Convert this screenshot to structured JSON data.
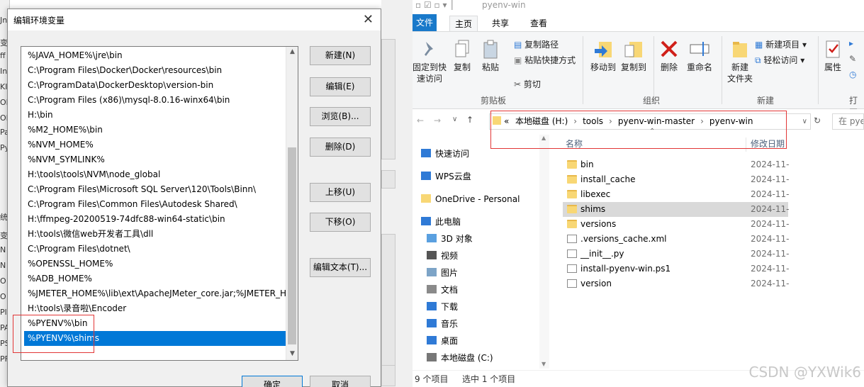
{
  "behind_window": {
    "fragments": [
      "Jn",
      "变",
      "ff",
      "In",
      "KI",
      "Ol",
      "OI",
      "Pa",
      "Py",
      "统",
      "变",
      "N",
      "N",
      "O",
      "O",
      "Pl",
      "PA",
      "PS",
      "PF"
    ]
  },
  "dialog": {
    "title": "编辑环境变量",
    "entries": [
      "%JAVA_HOME%\\jre\\bin",
      "C:\\Program Files\\Docker\\Docker\\resources\\bin",
      "C:\\ProgramData\\DockerDesktop\\version-bin",
      "C:\\Program Files (x86)\\mysql-8.0.16-winx64\\bin",
      "H:\\bin",
      "%M2_HOME%\\bin",
      "%NVM_HOME%",
      "%NVM_SYMLINK%",
      "H:\\tools\\tools\\NVM\\node_global",
      "C:\\Program Files\\Microsoft SQL Server\\120\\Tools\\Binn\\",
      "C:\\Program Files\\Common Files\\Autodesk Shared\\",
      "H:\\ffmpeg-20200519-74dfc88-win64-static\\bin",
      "H:\\tools\\微信web开发者工具\\dll",
      "C:\\Program Files\\dotnet\\",
      "%OPENSSL_HOME%",
      "%ADB_HOME%",
      "%JMETER_HOME%\\lib\\ext\\ApacheJMeter_core.jar;%JMETER_H...",
      "H:\\tools\\录音啦\\Encoder",
      "%PYENV%\\bin",
      "%PYENV%\\shims"
    ],
    "selected_index": 19,
    "buttons": {
      "new": "新建(N)",
      "edit": "编辑(E)",
      "browse": "浏览(B)...",
      "delete": "删除(D)",
      "move_up": "上移(U)",
      "move_down": "下移(O)",
      "edit_text": "编辑文本(T)...",
      "ok": "确定",
      "cancel": "取消"
    },
    "close_glyph": "✕"
  },
  "explorer": {
    "window_title": "pyenv-win",
    "tabs": {
      "file": "文件",
      "home": "主页",
      "share": "共享",
      "view": "查看"
    },
    "ribbon": {
      "pin": "固定到快\n速访问",
      "copy": "复制",
      "paste": "粘贴",
      "copy_path": "复制路径",
      "paste_shortcut": "粘贴快捷方式",
      "cut": "剪切",
      "clipboard_group": "剪贴板",
      "move_to": "移动到",
      "copy_to": "复制到",
      "delete": "删除",
      "rename": "重命名",
      "organize_group": "组织",
      "new_folder": "新建\n文件夹",
      "new_item": "新建项目",
      "easy_access": "轻松访问",
      "new_group": "新建",
      "properties": "属性",
      "open_group": "打开"
    },
    "address": {
      "prefix": "«",
      "parts": [
        "本地磁盘 (H:)",
        "tools",
        "pyenv-win-master",
        "pyenv-win"
      ],
      "sep": "›",
      "search_placeholder": "在 pye"
    },
    "nav": [
      {
        "label": "快速访问",
        "icon": "star-icon",
        "color": "#2f7ad6"
      },
      {
        "label": "WPS云盘",
        "icon": "cloud-icon",
        "color": "#2f7ad6"
      },
      {
        "label": "OneDrive - Personal",
        "icon": "folder-icon",
        "color": "#f8d775"
      },
      {
        "label": "此电脑",
        "icon": "computer-icon",
        "color": "#2f7ad6"
      },
      {
        "label": "3D 对象",
        "icon": "cube-icon",
        "color": "#5aa0e0"
      },
      {
        "label": "视频",
        "icon": "video-icon",
        "color": "#555"
      },
      {
        "label": "图片",
        "icon": "pictures-icon",
        "color": "#7da4c7"
      },
      {
        "label": "文档",
        "icon": "documents-icon",
        "color": "#8a8a8a"
      },
      {
        "label": "下载",
        "icon": "download-icon",
        "color": "#2f7ad6"
      },
      {
        "label": "音乐",
        "icon": "music-icon",
        "color": "#2f7ad6"
      },
      {
        "label": "桌面",
        "icon": "desktop-icon",
        "color": "#2f7ad6"
      },
      {
        "label": "本地磁盘 (C:)",
        "icon": "drive-icon",
        "color": "#777"
      }
    ],
    "columns": {
      "name": "名称",
      "date": "修改日期"
    },
    "files": [
      {
        "name": "bin",
        "date": "2024-11-",
        "type": "folder"
      },
      {
        "name": "install_cache",
        "date": "2024-11-",
        "type": "folder"
      },
      {
        "name": "libexec",
        "date": "2024-11-",
        "type": "folder"
      },
      {
        "name": "shims",
        "date": "2024-11-",
        "type": "folder"
      },
      {
        "name": "versions",
        "date": "2024-11-",
        "type": "folder"
      },
      {
        "name": ".versions_cache.xml",
        "date": "2024-11-",
        "type": "xml"
      },
      {
        "name": "__init__.py",
        "date": "2024-11-",
        "type": "py"
      },
      {
        "name": "install-pyenv-win.ps1",
        "date": "2024-11-",
        "type": "ps1"
      },
      {
        "name": "version",
        "date": "2024-11-",
        "type": "file"
      }
    ],
    "selected_file": 3,
    "status": {
      "count": "9 个项目",
      "selected": "选中 1 个项目"
    }
  },
  "watermark": "CSDN @YXWik6",
  "colors": {
    "selection": "#0078d7",
    "highlight_box": "#e23636",
    "file_tab": "#1979ca"
  }
}
